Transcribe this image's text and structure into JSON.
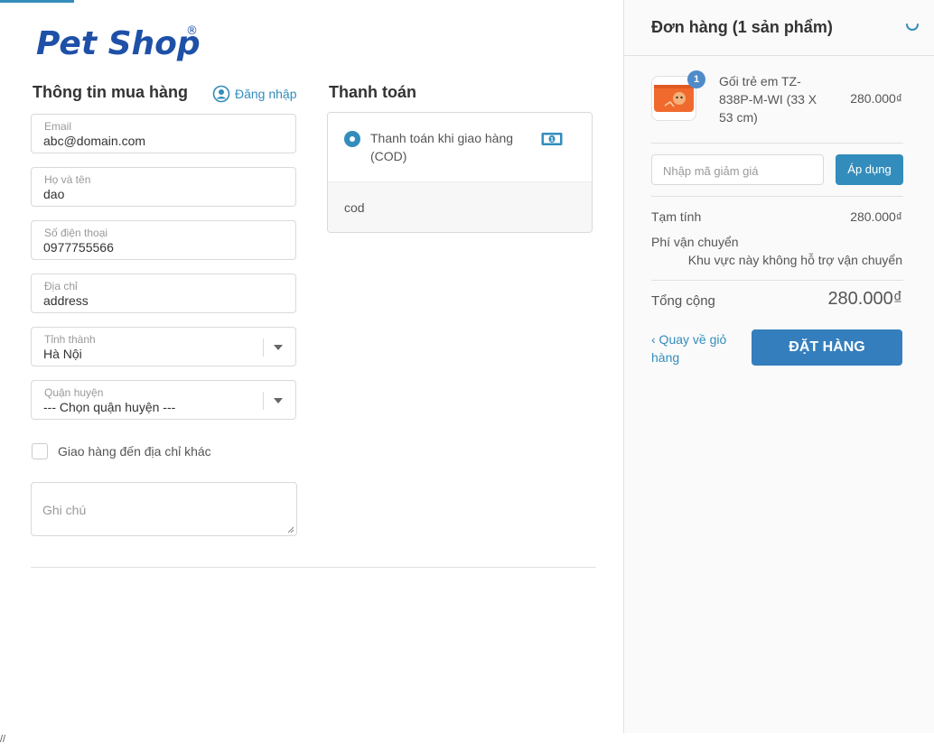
{
  "logo": {
    "text": "Pet Shop",
    "registered": "®"
  },
  "customer": {
    "title": "Thông tin mua hàng",
    "login_label": "Đăng nhập",
    "fields": [
      {
        "label": "Email",
        "value": "abc@domain.com"
      },
      {
        "label": "Họ và tên",
        "value": "dao"
      },
      {
        "label": "Số điện thoại",
        "value": "0977755566"
      },
      {
        "label": "Địa chỉ",
        "value": "address"
      },
      {
        "label": "Tỉnh thành",
        "value": "Hà Nội"
      },
      {
        "label": "Quận huyện",
        "value": "--- Chọn quận huyện ---"
      }
    ],
    "ship_other_label": "Giao hàng đến địa chỉ khác",
    "note_placeholder": "Ghi chú"
  },
  "payment": {
    "title": "Thanh toán",
    "option_label": "Thanh toán khi giao hàng (COD)",
    "option_desc": "cod"
  },
  "order": {
    "title": "Đơn hàng (1 sản phẩm)",
    "item": {
      "name": "Gối trẻ em TZ-838P-M-WI (33 X 53 cm)",
      "qty": "1",
      "price": "280.000₫"
    },
    "discount_placeholder": "Nhập mã giảm giá",
    "apply_label": "Áp dụng",
    "subtotal_label": "Tạm tính",
    "subtotal_value": "280.000₫",
    "shipping_label": "Phí vận chuyển",
    "shipping_note": "Khu vực này không hỗ trợ vận chuyển",
    "total_label": "Tổng cộng",
    "total_value": "280.000₫",
    "back_label": "‹ Quay về giỏ hàng",
    "submit_label": "ĐẶT HÀNG"
  },
  "footer_mark": "//",
  "colors": {
    "accent": "#338dbc",
    "button": "#357ebd",
    "logo_blue": "#1e50a8"
  }
}
